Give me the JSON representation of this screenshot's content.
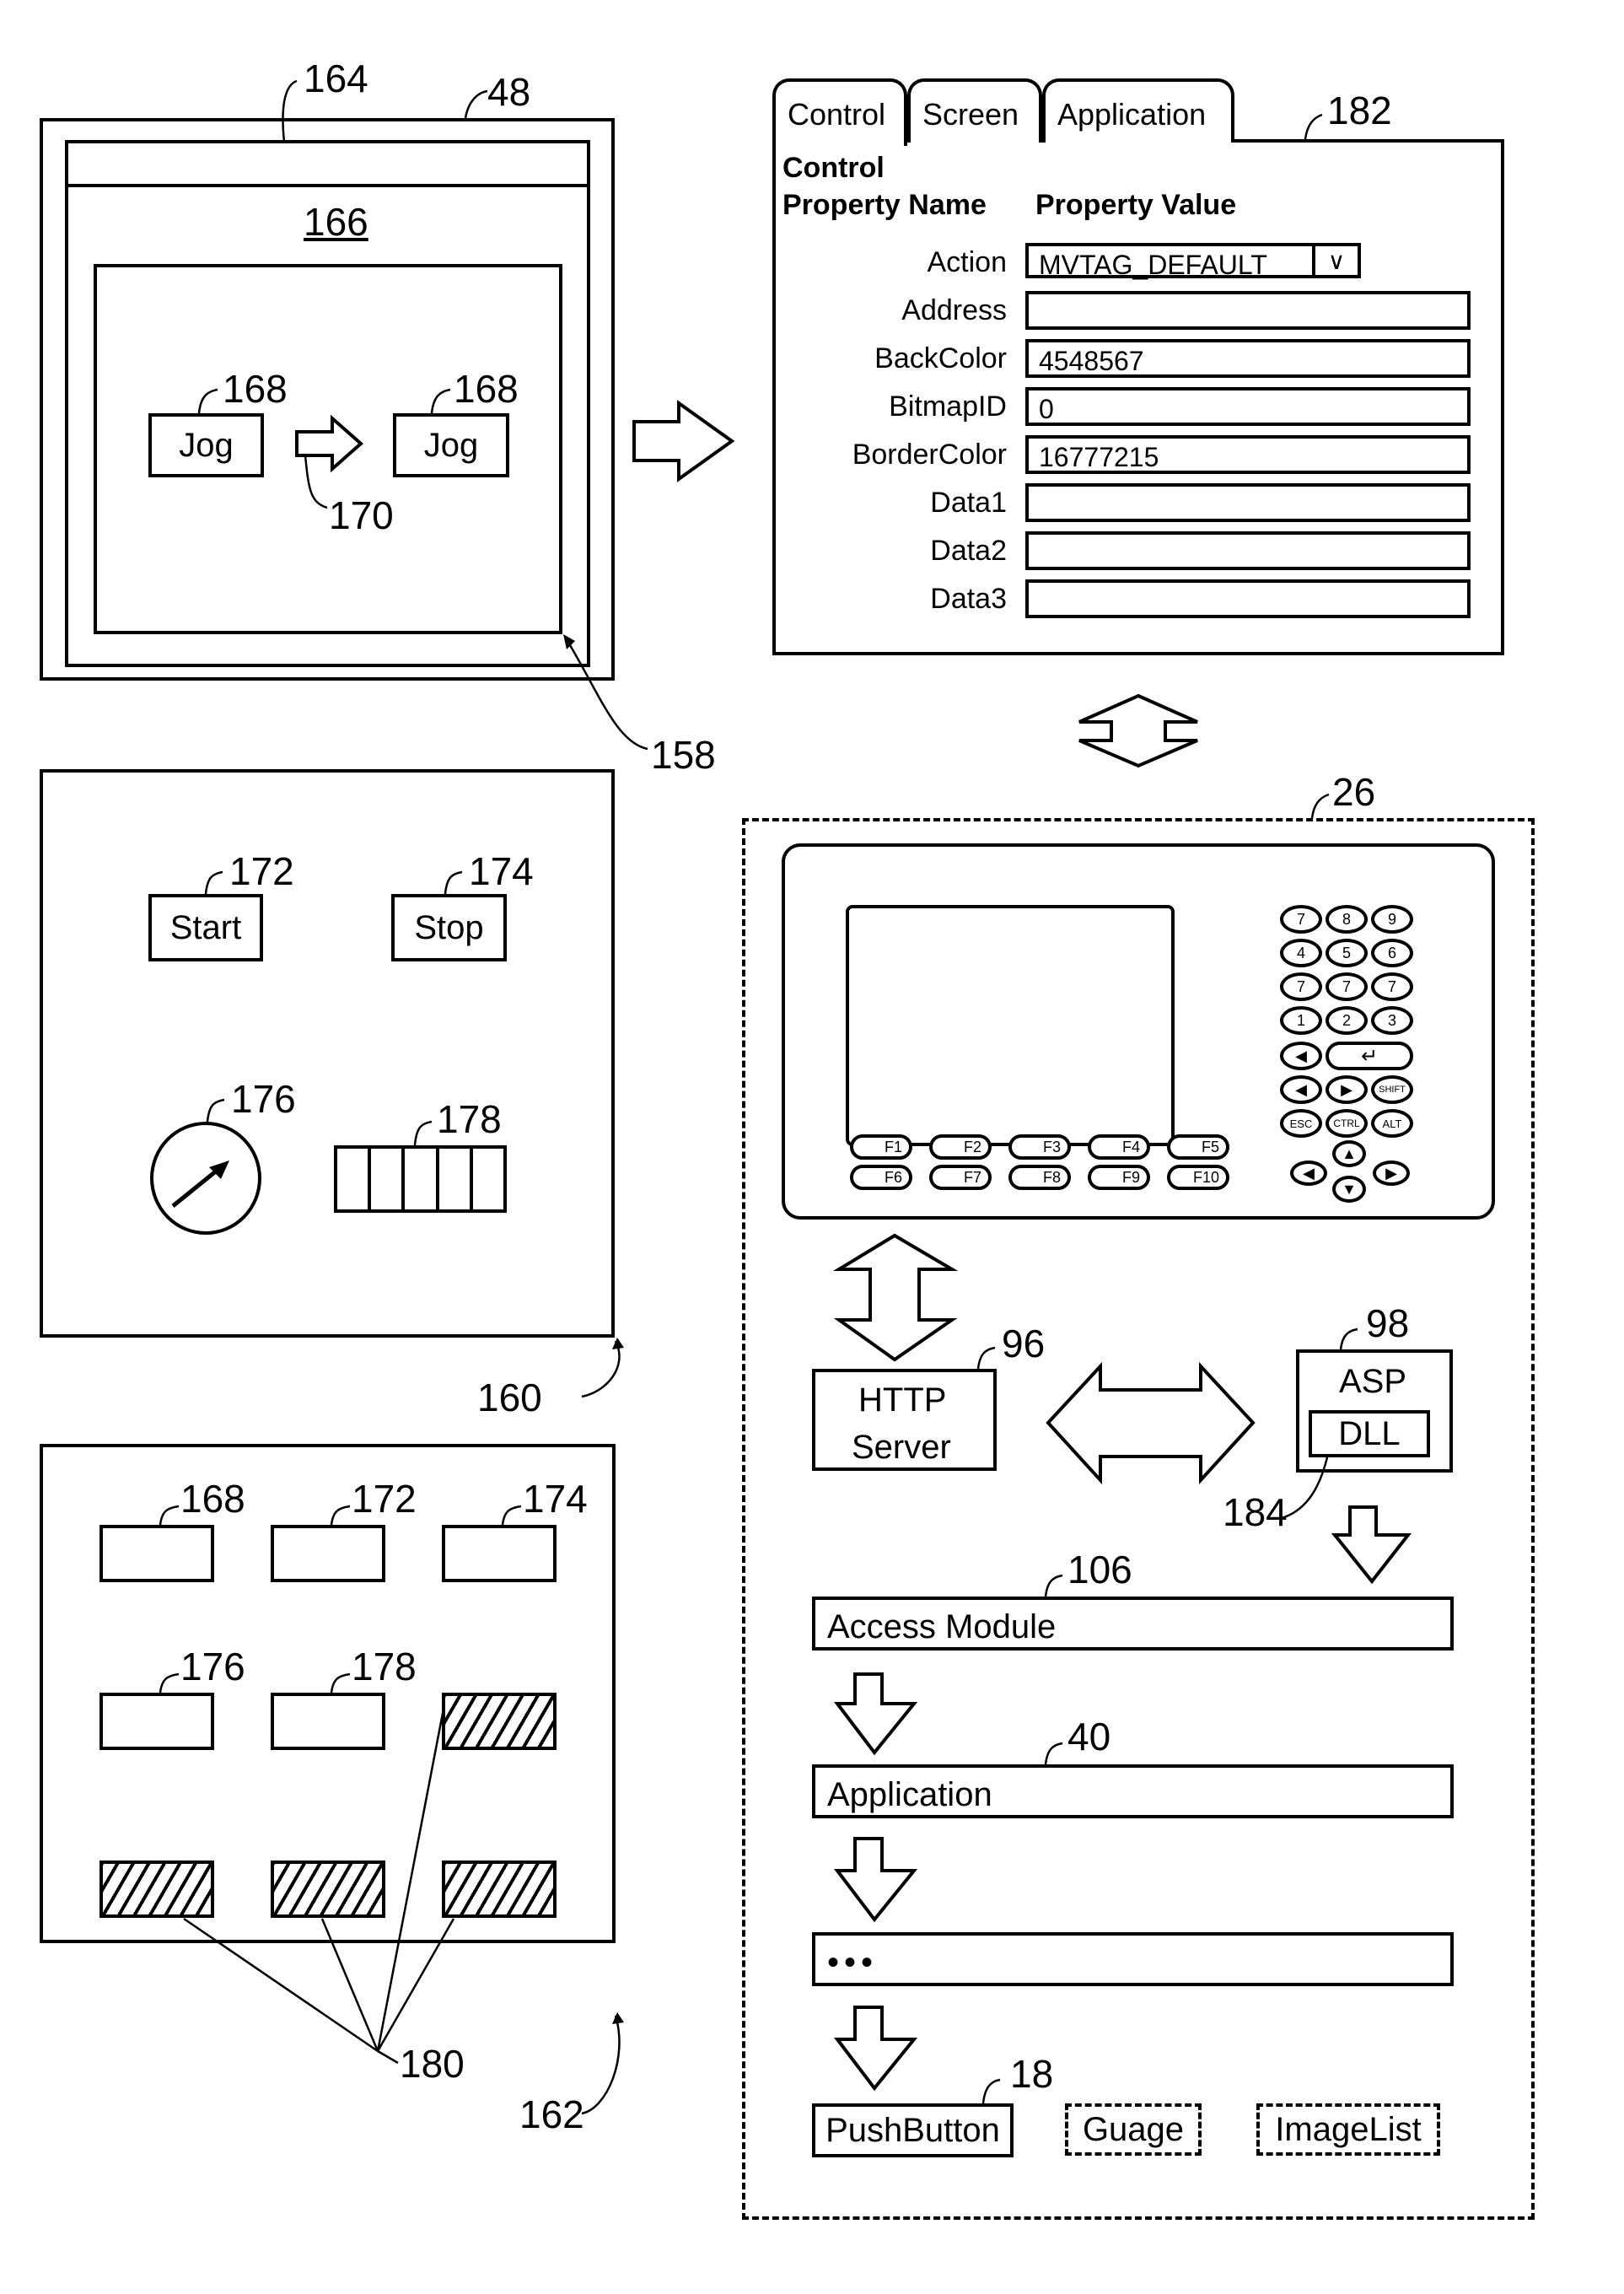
{
  "figure": {
    "refs": {
      "window": "48",
      "title_bar": "164",
      "screen_area": "166",
      "edit_region": "158",
      "screen_160": "160",
      "screen_162": "162",
      "property_panel": "182",
      "terminal": "26",
      "http_server": "96",
      "asp": "98",
      "dll": "184",
      "access_module": "106",
      "application": "40",
      "pushbutton": "18",
      "drag_arrow": "170",
      "free_slots": "180"
    }
  },
  "editor_window": {
    "jog_button_label": "Jog",
    "jog_ref": "168"
  },
  "screen160": {
    "start_label": "Start",
    "start_ref": "172",
    "stop_label": "Stop",
    "stop_ref": "174",
    "gauge_ref": "176",
    "imagelist_ref": "178",
    "imagelist_cells": 5
  },
  "screen162": {
    "slots": [
      {
        "ref": "168",
        "hatched": false
      },
      {
        "ref": "172",
        "hatched": false
      },
      {
        "ref": "174",
        "hatched": false
      },
      {
        "ref": "176",
        "hatched": false
      },
      {
        "ref": "178",
        "hatched": false
      },
      {
        "ref": "",
        "hatched": true
      },
      {
        "ref": "",
        "hatched": true
      },
      {
        "ref": "",
        "hatched": true
      },
      {
        "ref": "",
        "hatched": true
      }
    ]
  },
  "property_panel": {
    "tabs": [
      "Control",
      "Screen",
      "Application"
    ],
    "active_tab": "Control",
    "section_title": "Control",
    "col_name_header": "Property Name",
    "col_value_header": "Property Value",
    "properties": [
      {
        "name": "Action",
        "value": "MVTAG_DEFAULT",
        "type": "dropdown"
      },
      {
        "name": "Address",
        "value": "",
        "type": "text"
      },
      {
        "name": "BackColor",
        "value": "4548567",
        "type": "text"
      },
      {
        "name": "BitmapID",
        "value": "0",
        "type": "text"
      },
      {
        "name": "BorderColor",
        "value": "16777215",
        "type": "text"
      },
      {
        "name": "Data1",
        "value": "",
        "type": "text"
      },
      {
        "name": "Data2",
        "value": "",
        "type": "text"
      },
      {
        "name": "Data3",
        "value": "",
        "type": "text"
      }
    ],
    "dropdown_icon": "chevron-down-icon"
  },
  "terminal": {
    "keypad": [
      [
        "7",
        "8",
        "9"
      ],
      [
        "4",
        "5",
        "6"
      ],
      [
        "7",
        "7",
        "7"
      ],
      [
        "1",
        "2",
        "3"
      ]
    ],
    "special_keys": [
      "SHIFT",
      "ESC",
      "CTRL",
      "ALT"
    ],
    "function_keys": [
      "F1",
      "F2",
      "F3",
      "F4",
      "F5",
      "F6",
      "F7",
      "F8",
      "F9",
      "F10"
    ]
  },
  "stack": {
    "http_server_line1": "HTTP",
    "http_server_line2": "Server",
    "asp_label": "ASP",
    "dll_label": "DLL",
    "access_module_label": "Access Module",
    "application_label": "Application",
    "ellipsis_label": "•••",
    "controls": [
      "PushButton",
      "Guage",
      "ImageList"
    ]
  }
}
